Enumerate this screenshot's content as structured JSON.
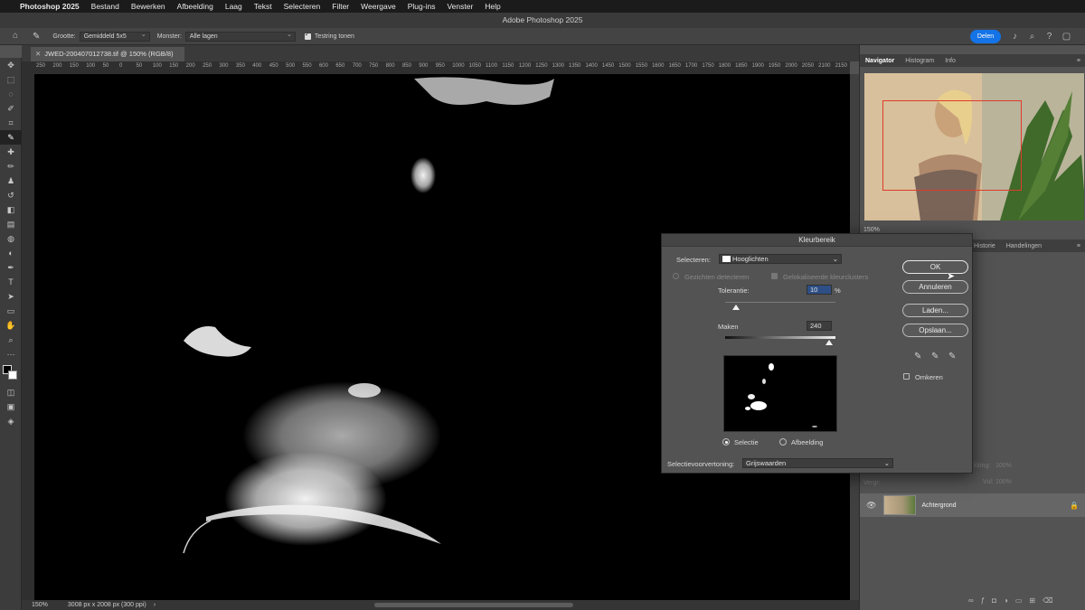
{
  "menubar": {
    "app": "Photoshop 2025",
    "items": [
      "Bestand",
      "Bewerken",
      "Afbeelding",
      "Laag",
      "Tekst",
      "Selecteren",
      "Filter",
      "Weergave",
      "Plug-ins",
      "Venster",
      "Help"
    ]
  },
  "window_title": "Adobe Photoshop 2025",
  "options": {
    "size_label": "Grootte:",
    "size_value": "Gemiddeld 5x5",
    "sample_label": "Monster:",
    "sample_value": "Alle lagen",
    "ring_label": "Testring tonen",
    "share_label": "Delen"
  },
  "document": {
    "tab_title": "JWED-200407012738.tif @ 150% (RGB/8)",
    "ruler_ticks": [
      "250",
      "200",
      "150",
      "100",
      "50",
      "0",
      "50",
      "100",
      "150",
      "200",
      "250",
      "300",
      "350",
      "400",
      "450",
      "500",
      "550",
      "600",
      "650",
      "700",
      "750",
      "800",
      "850",
      "900",
      "950",
      "1000",
      "1050",
      "1100",
      "1150",
      "1200",
      "1250",
      "1300",
      "1350",
      "1400",
      "1450",
      "1500",
      "1550",
      "1600",
      "1650",
      "1700",
      "1750",
      "1800",
      "1850",
      "1900",
      "1950",
      "2000",
      "2050",
      "2100",
      "2150"
    ],
    "zoom": "150%",
    "doc_info": "3008 px x 2008 px (300 ppi)"
  },
  "panels": {
    "top_tabs": [
      "Navigator",
      "Histogram",
      "Info"
    ],
    "nav_zoom": "150%",
    "mid_tabs": [
      "Historie",
      "Handelingen"
    ],
    "layer_fields": {
      "opacity_label": "kking:",
      "opacity_value": "100%",
      "fill_label": "Vul:",
      "fill_value": "100%",
      "lock_label": "Vergr:"
    },
    "layer_name": "Achtergrond"
  },
  "dialog": {
    "title": "Kleurbereik",
    "select_label": "Selecteren:",
    "select_value": "Hooglichten",
    "detect_faces": "Gezichten detecteren",
    "localized": "Gelokaliseerde kleurclusters",
    "tolerance_label": "Tolerantie:",
    "tolerance_value": "10",
    "percent": "%",
    "range_label": "Maken",
    "range_value": "240",
    "radio_selection": "Selectie",
    "radio_image": "Afbeelding",
    "preview_label": "Selectievoorvertoning:",
    "preview_value": "Grijswaarden",
    "ok": "OK",
    "cancel": "Annuleren",
    "load": "Laden...",
    "save": "Opslaan...",
    "invert": "Omkeren",
    "tolerance_fraction": 0.1,
    "range_fraction": 0.94
  }
}
